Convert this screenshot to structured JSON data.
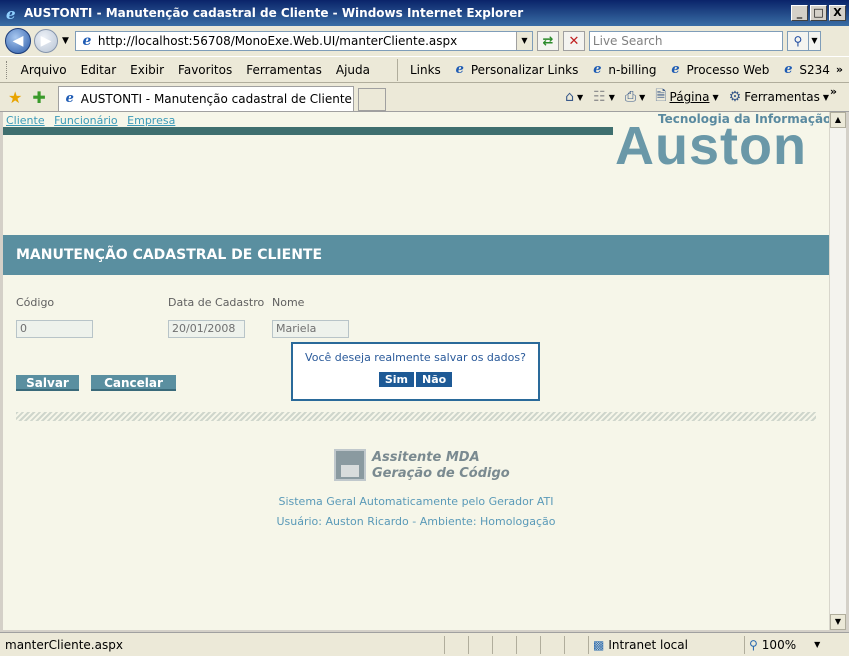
{
  "window": {
    "title": "AUSTONTI - Manutenção cadastral de Cliente - Windows Internet Explorer",
    "min": "_",
    "max": "□",
    "close": "X"
  },
  "address": {
    "url": "http://localhost:56708/MonoExe.Web.UI/manterCliente.aspx",
    "search_placeholder": "Live Search"
  },
  "menu": {
    "items": [
      "Arquivo",
      "Editar",
      "Exibir",
      "Favoritos",
      "Ferramentas",
      "Ajuda"
    ],
    "links_label": "Links",
    "links": [
      "Personalizar Links",
      "n-billing",
      "Processo Web",
      "S234"
    ]
  },
  "tabs": {
    "active": "AUSTONTI - Manutenção cadastral de Cliente",
    "page_label": "Página",
    "tools_label": "Ferramentas"
  },
  "page": {
    "top_links": [
      "Cliente",
      "Funcionário",
      "Empresa"
    ],
    "logo_small": "Tecnologia da Informação",
    "logo_big": "Auston",
    "banner": "MANUTENÇÃO CADASTRAL DE CLIENTE",
    "fields": {
      "codigo_label": "Código",
      "codigo_value": "0",
      "data_label": "Data de Cadastro",
      "data_value": "20/01/2008",
      "nome_label": "Nome",
      "nome_value": "Mariela"
    },
    "buttons": {
      "save": "Salvar",
      "cancel": "Cancelar"
    },
    "dialog": {
      "question": "Você deseja realmente salvar os dados?",
      "yes": "Sim",
      "no": "Não"
    },
    "mda_line1": "Assitente MDA",
    "mda_line2": "Geração de Código",
    "footer1": "Sistema Geral Automaticamente pelo Gerador ATI",
    "footer2": "Usuário: Auston Ricardo - Ambiente: Homologação"
  },
  "status": {
    "text": "manterCliente.aspx",
    "zone": "Intranet local",
    "zoom": "100%"
  }
}
